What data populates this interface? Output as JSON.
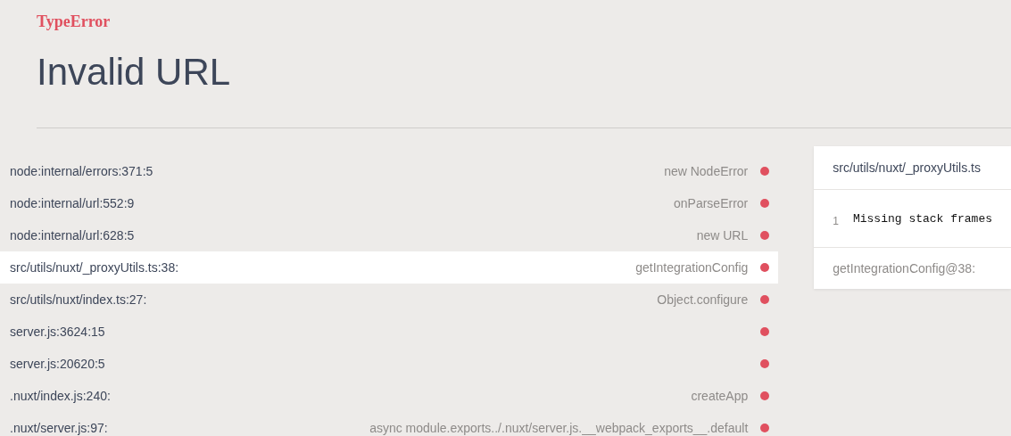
{
  "error": {
    "type": "TypeError",
    "message": "Invalid URL"
  },
  "frames": [
    {
      "location": "node:internal/errors:371:5",
      "function": "new NodeError",
      "selected": false
    },
    {
      "location": "node:internal/url:552:9",
      "function": "onParseError",
      "selected": false
    },
    {
      "location": "node:internal/url:628:5",
      "function": "new URL",
      "selected": false
    },
    {
      "location": "src/utils/nuxt/_proxyUtils.ts:38:",
      "function": "getIntegrationConfig",
      "selected": true
    },
    {
      "location": "src/utils/nuxt/index.ts:27:",
      "function": "Object.configure",
      "selected": false
    },
    {
      "location": "server.js:3624:15",
      "selected": false
    },
    {
      "location": "server.js:20620:5",
      "selected": false
    },
    {
      "location": ".nuxt/index.js:240:",
      "function": "createApp",
      "selected": false
    },
    {
      "location": ".nuxt/server.js:97:",
      "function": "async module.exports../.nuxt/server.js.__webpack_exports__.default",
      "selected": false
    }
  ],
  "source_panel": {
    "file": "src/utils/nuxt/_proxyUtils.ts",
    "lines": [
      {
        "number": "1",
        "code": "Missing stack frames"
      }
    ],
    "footer": "getIntegrationConfig@38:"
  }
}
